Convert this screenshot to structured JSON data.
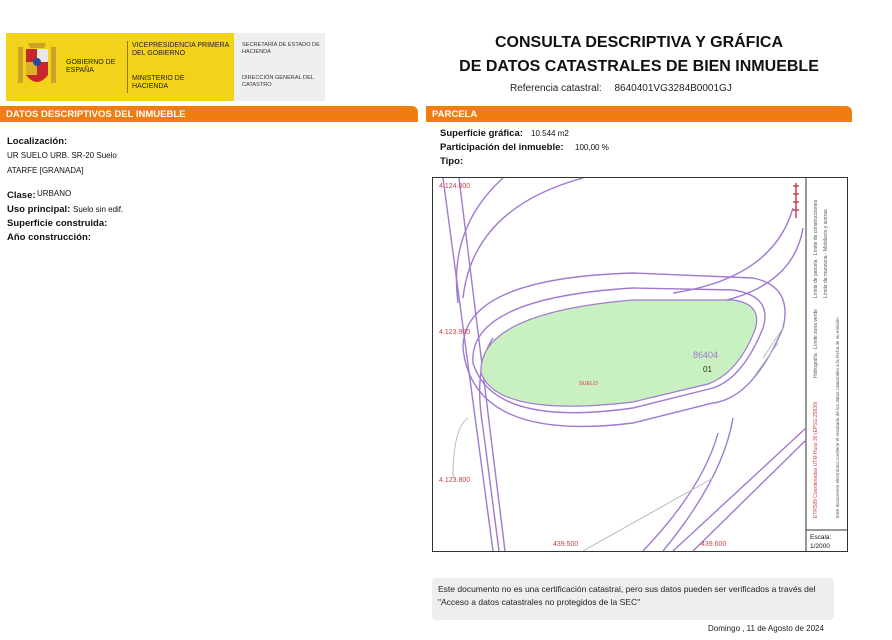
{
  "header": {
    "gobierno": "GOBIERNO DE ESPAÑA",
    "vicepresidencia": "VICEPRESIDENCIA PRIMERA DEL GOBIERNO",
    "ministerio": "MINISTERIO DE HACIENDA",
    "secretaria": "SECRETARÍA DE ESTADO DE HACIENDA",
    "direccion": "DIRECCIÓN GENERAL DEL CATASTRO",
    "title_line1": "CONSULTA DESCRIPTIVA Y GRÁFICA",
    "title_line2": "DE DATOS CATASTRALES DE BIEN INMUEBLE",
    "ref_label": "Referencia catastral:",
    "ref_value": "8640401VG3284B0001GJ"
  },
  "colors": {
    "accent": "#f07d10",
    "parcel_fill": "#c8f0c0",
    "road_line": "#a07ad0",
    "label_red": "#d04040"
  },
  "left": {
    "section_title": "DATOS DESCRIPTIVOS DEL INMUEBLE",
    "localizacion_label": "Localización:",
    "localizacion_line1": "UR SUELO URB. SR-20  Suelo",
    "localizacion_line2": "ATARFE [GRANADA]",
    "clase_label": "Clase:",
    "clase_value": "URBANO",
    "uso_label": "Uso principal:",
    "uso_value": "Suelo sin edif.",
    "superficie_label": "Superficie construida:",
    "anio_label": "Año construcción:"
  },
  "right": {
    "section_title": "PARCELA",
    "superficie_label": "Superficie gráfica:",
    "superficie_value": "10.544 m2",
    "participacion_label": "Participación del inmueble:",
    "participacion_value": "100,00 %",
    "tipo_label": "Tipo:"
  },
  "map": {
    "coord_top": "4.124.000",
    "coord_mid": "4.123.900",
    "coord_bottom": "4.123.800",
    "coord_x1": "439.500",
    "coord_x2": "439.600",
    "parcel_number": "86404",
    "parcel_sub": "01",
    "parcel_use": "SUELO",
    "escala_label": "Escala:",
    "escala_value": "1/2000",
    "legend_col1": "Límite de parcela · Límite de construcciones",
    "legend_col2": "Límite de manzana · Mobiliario y aceras",
    "legend_col3": "Hidrografía · Límite zona verde",
    "coord_system": "ETRS89 Coordenadas UTM Huso 30 (EPSG:25830)",
    "doc_note": "Este documento electrónico contiene el resultado de los datos catastrales a la fecha de su emisión"
  },
  "footer": {
    "notice": "Este documento no es una certificación catastral, pero sus datos pueden ser verificados a través del \"Acceso a datos catastrales no protegidos de la SEC\"",
    "date": "Domingo , 11 de Agosto de 2024"
  }
}
